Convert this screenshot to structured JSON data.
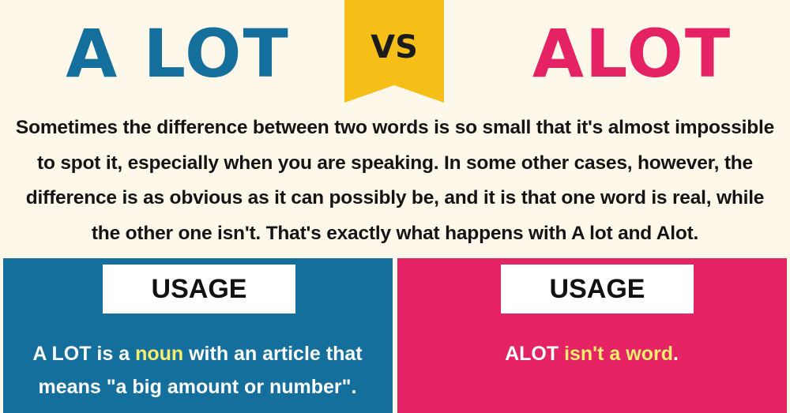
{
  "header": {
    "left_title": "A LOT",
    "vs_label": "VS",
    "right_title": "ALOT"
  },
  "intro": {
    "lines": [
      "Sometimes the difference between two words is so small that it's almost impossible",
      "to spot it, especially when you are speaking. In some other cases, however, the",
      "difference is as obvious as it can possibly be, and it is that one word is real, while",
      "the other one isn't. That's exactly what happens with A lot and Alot."
    ]
  },
  "left_panel": {
    "heading": "USAGE",
    "line1_before": "A LOT is a ",
    "line1_highlight": "noun",
    "line1_after": " with an article that",
    "line2": "means \"a big amount or number\"."
  },
  "right_panel": {
    "heading": "USAGE",
    "before": "ALOT ",
    "highlight": "isn't a word",
    "after": "."
  },
  "colors": {
    "background": "#fdf8ea",
    "blue": "#156f9c",
    "pink": "#e52264",
    "yellow_ribbon": "#f5bf17",
    "highlight_text": "#f8ed6d",
    "white": "#ffffff"
  }
}
